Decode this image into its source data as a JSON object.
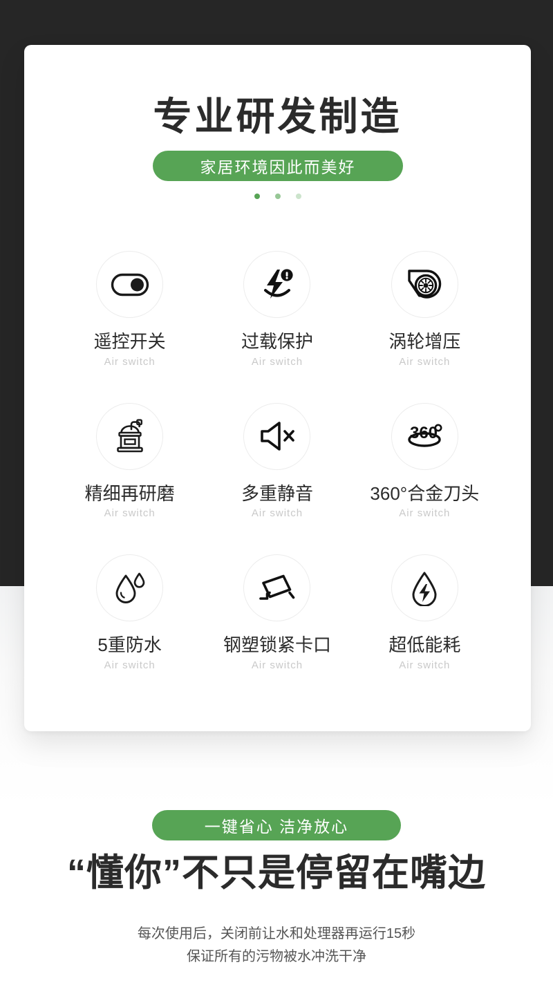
{
  "header": {
    "title": "专业研发制造",
    "badge": "家居环境因此而美好",
    "dots": [
      "dot-active",
      "dot-dim",
      "dot-faint"
    ]
  },
  "features": [
    {
      "icon": "toggle-switch-icon",
      "title": "遥控开关",
      "subtitle": "Air switch"
    },
    {
      "icon": "overload-bolt-icon",
      "title": "过载保护",
      "subtitle": "Air switch"
    },
    {
      "icon": "turbocharger-icon",
      "title": "涡轮增压",
      "subtitle": "Air switch"
    },
    {
      "icon": "grinder-icon",
      "title": "精细再研磨",
      "subtitle": "Air switch"
    },
    {
      "icon": "speaker-mute-icon",
      "title": "多重静音",
      "subtitle": "Air switch"
    },
    {
      "icon": "three-sixty-icon",
      "title": "360°合金刀头",
      "subtitle": "Air switch"
    },
    {
      "icon": "water-drops-icon",
      "title": "5重防水",
      "subtitle": "Air switch"
    },
    {
      "icon": "security-camera-icon",
      "title": "钢塑锁紧卡口",
      "subtitle": "Air switch"
    },
    {
      "icon": "drop-energy-icon",
      "title": "超低能耗",
      "subtitle": "Air switch"
    }
  ],
  "footer": {
    "badge": "一键省心 洁净放心",
    "headline": "“懂你”不只是停留在嘴边",
    "note_line1": "每次使用后，关闭前让水和处理器再运行15秒",
    "note_line2": "保证所有的污物被水冲洗干净"
  },
  "colors": {
    "accent_green": "#57a455",
    "dark_backdrop": "#262626",
    "title_text": "#2b2b2b",
    "subtitle_text": "#c9c9c9",
    "circle_border": "#ececec"
  }
}
